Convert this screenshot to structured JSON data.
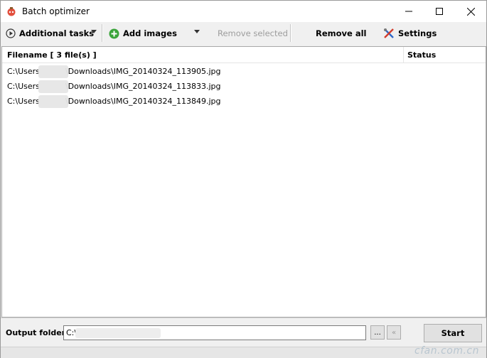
{
  "window": {
    "title": "Batch optimizer",
    "controls": {
      "minimize": "—",
      "maximize": "☐",
      "close": "✕"
    }
  },
  "toolbar": {
    "additional_tasks": "Additional tasks",
    "add_images": "Add images",
    "remove_selected": "Remove selected",
    "remove_all": "Remove all",
    "settings": "Settings"
  },
  "list": {
    "header_filename": "Filename [ 3 file(s) ]",
    "header_status": "Status",
    "rows": [
      {
        "path_start": "C:\\Users",
        "path_end": "\\Downloads\\IMG_20140324_113905.jpg"
      },
      {
        "path_start": "C:\\Users",
        "path_end": "\\Downloads\\IMG_20140324_113833.jpg"
      },
      {
        "path_start": "C:\\Users",
        "path_end": "\\Downloads\\IMG_20140324_113849.jpg"
      }
    ]
  },
  "output": {
    "label": "Output folder:",
    "value": "C:\\",
    "browse_label": "...",
    "back_label": "«"
  },
  "start_label": "Start",
  "watermark": "cfan.com.cn",
  "colors": {
    "add_icon_green": "#3aa43a",
    "settings_red": "#d23b2b",
    "settings_blue": "#2c66c8"
  }
}
